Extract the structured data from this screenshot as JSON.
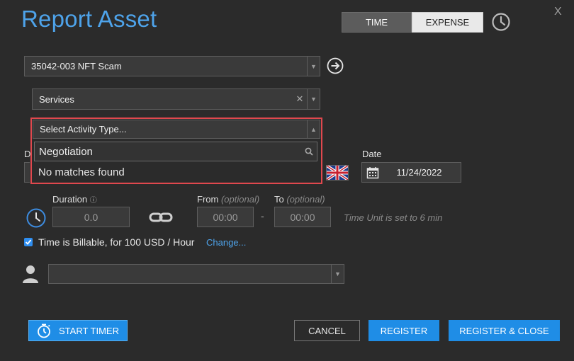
{
  "window": {
    "title": "Report Asset",
    "close_label": "X"
  },
  "mode_toggle": {
    "time_label": "TIME",
    "expense_label": "EXPENSE",
    "selected": "TIME"
  },
  "matter": {
    "value": "35042-003 NFT Scam"
  },
  "service": {
    "value": "Services"
  },
  "activity": {
    "placeholder": "Select Activity Type...",
    "search_value": "Negotiation",
    "no_results": "No matches found"
  },
  "partial_label": "D",
  "date": {
    "label": "Date",
    "value": "11/24/2022"
  },
  "duration": {
    "label": "Duration",
    "info_icon": "ⓘ",
    "value": "0.0",
    "from_label": "From",
    "from_optional": "(optional)",
    "from_value": "00:00",
    "to_label": "To",
    "to_optional": "(optional)",
    "to_value": "00:00",
    "separator": "-",
    "unit_note": "Time Unit is set to 6 min"
  },
  "billable": {
    "checked": true,
    "text": "Time is Billable, for 100 USD / Hour",
    "change_link": "Change..."
  },
  "user": {
    "value": ""
  },
  "buttons": {
    "start_timer": "START TIMER",
    "cancel": "CANCEL",
    "register": "REGISTER",
    "register_close": "REGISTER & CLOSE"
  },
  "colors": {
    "background": "#2b2b2b",
    "accent": "#1f8de6",
    "title": "#4ea3ea",
    "highlight_border": "#e0484e"
  },
  "icons": {
    "clock": "clock-icon",
    "navigate": "arrow-right-circle-icon",
    "clear": "close-icon",
    "search": "search-icon",
    "flag": "uk-flag-icon",
    "calendar": "calendar-icon",
    "link": "chain-link-icon",
    "person": "person-icon",
    "stopwatch": "stopwatch-icon"
  }
}
